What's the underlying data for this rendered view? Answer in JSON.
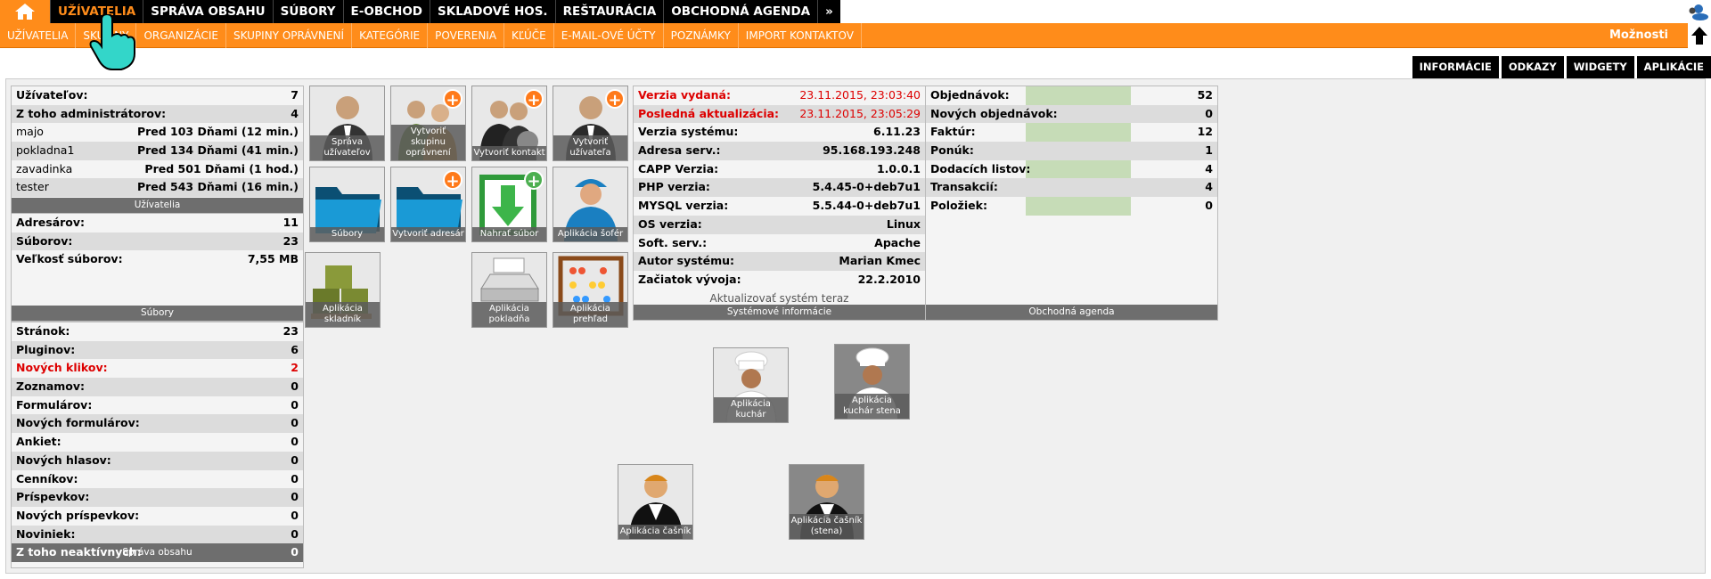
{
  "topnav": {
    "items": [
      "UŽÍVATELIA",
      "SPRÁVA OBSAHU",
      "SÚBORY",
      "E-OBCHOD",
      "SKLADOVÉ HOS.",
      "REŠTAURÁCIA",
      "OBCHODNÁ AGENDA",
      "»"
    ]
  },
  "subnav": {
    "items": [
      "UŽÍVATELIA",
      "SKUPINY",
      "ORGANIZÁCIE",
      "SKUPINY OPRÁVNENÍ",
      "KATEGÓRIE",
      "POVERENIA",
      "KĽÚČE",
      "E-MAIL-OVÉ ÚČTY",
      "POZNÁMKY",
      "IMPORT KONTAKTOV"
    ],
    "options": "Možnosti"
  },
  "tabs": [
    "INFORMÁCIE",
    "ODKAZY",
    "WIDGETY",
    "APLIKÁCIE"
  ],
  "users_panel": {
    "title": "Užívatelia",
    "rows": [
      {
        "k": "Užívateľov:",
        "v": "7"
      },
      {
        "k": "Z toho administrátorov:",
        "v": "4"
      },
      {
        "k": "majo",
        "v": "Pred 103 Dňami (12 min.)"
      },
      {
        "k": "pokladna1",
        "v": "Pred 134 Dňami (41 min.)"
      },
      {
        "k": "zavadinka",
        "v": "Pred 501 Dňami (1 hod.)"
      },
      {
        "k": "tester",
        "v": "Pred 543 Dňami (16 min.)"
      }
    ]
  },
  "files_panel": {
    "title": "Súbory",
    "rows": [
      {
        "k": "Adresárov:",
        "v": "11"
      },
      {
        "k": "Súborov:",
        "v": "23"
      },
      {
        "k": "Veľkosť súborov:",
        "v": "7,55 MB"
      }
    ]
  },
  "content_panel": {
    "title": "Správa obsahu",
    "rows": [
      {
        "k": "Stránok:",
        "v": "23"
      },
      {
        "k": "Pluginov:",
        "v": "6"
      },
      {
        "k": "Nových klikov:",
        "v": "2"
      },
      {
        "k": "Zoznamov:",
        "v": "0"
      },
      {
        "k": "Formulárov:",
        "v": "0"
      },
      {
        "k": "Nových formulárov:",
        "v": "0"
      },
      {
        "k": "Ankiet:",
        "v": "0"
      },
      {
        "k": "Nových hlasov:",
        "v": "0"
      },
      {
        "k": "Cenníkov:",
        "v": "0"
      },
      {
        "k": "Príspevkov:",
        "v": "0"
      },
      {
        "k": "Nových príspevkov:",
        "v": "0"
      },
      {
        "k": "Noviniek:",
        "v": "0"
      },
      {
        "k": "Z toho neaktívnych:",
        "v": "0"
      }
    ]
  },
  "system_panel": {
    "title": "Systémové informácie",
    "update_text": "Aktualizovať systém teraz",
    "rows": [
      {
        "k": "Verzia vydaná:",
        "v": "23.11.2015, 23:03:40"
      },
      {
        "k": "Posledná aktualizácia:",
        "v": "23.11.2015, 23:05:29"
      },
      {
        "k": "Verzia systému:",
        "v": "6.11.23"
      },
      {
        "k": "Adresa serv.:",
        "v": "95.168.193.248"
      },
      {
        "k": "CAPP Verzia:",
        "v": "1.0.0.1"
      },
      {
        "k": "PHP verzia:",
        "v": "5.4.45-0+deb7u1"
      },
      {
        "k": "MYSQL verzia:",
        "v": "5.5.44-0+deb7u1"
      },
      {
        "k": "OS verzia:",
        "v": "Linux"
      },
      {
        "k": "Soft. serv.:",
        "v": "Apache"
      },
      {
        "k": "Autor systému:",
        "v": "Marian Kmec"
      },
      {
        "k": "Začiatok vývoja:",
        "v": "22.2.2010"
      }
    ]
  },
  "agenda_panel": {
    "title": "Obchodná agenda",
    "rows": [
      {
        "k": "Objednávok:",
        "v": "52"
      },
      {
        "k": "Nových objednávok:",
        "v": "0"
      },
      {
        "k": "Faktúr:",
        "v": "12"
      },
      {
        "k": "Ponúk:",
        "v": "1"
      },
      {
        "k": "Dodacích listov:",
        "v": "4"
      },
      {
        "k": "Transakcií:",
        "v": "4"
      },
      {
        "k": "Položiek:",
        "v": "0"
      }
    ]
  },
  "apps": [
    {
      "label": "Správa užívateľov"
    },
    {
      "label": "Vytvoriť skupinu oprávnení"
    },
    {
      "label": "Vytvoriť kontakt"
    },
    {
      "label": "Vytvoriť užívateľa"
    },
    {
      "label": "Súbory"
    },
    {
      "label": "Vytvoriť adresár"
    },
    {
      "label": "Nahrať súbor"
    },
    {
      "label": "Aplikácia šofér"
    },
    {
      "label": "Aplikácia skladník"
    },
    {
      "label": "Aplikácia pokladňa"
    },
    {
      "label": "Aplikácia prehľad"
    },
    {
      "label": "Aplikácia kuchár"
    },
    {
      "label": "Aplikácia kuchár stena"
    },
    {
      "label": "Aplikácia čašník"
    },
    {
      "label": "Aplikácia čašník (stena)"
    }
  ]
}
